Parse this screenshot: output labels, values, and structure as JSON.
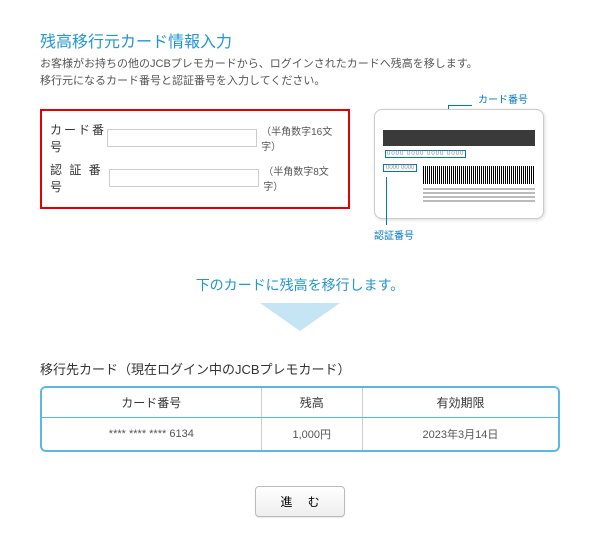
{
  "header": {
    "title": "残高移行元カード情報入力",
    "desc_line1": "お客様がお持ちの他のJCBプレモカードから、ログインされたカードへ残高を移します。",
    "desc_line2": "移行元になるカード番号と認証番号を入力してください。"
  },
  "form": {
    "card_label": "カード番号",
    "card_hint": "（半角数字16文字）",
    "auth_label": "認 証 番 号",
    "auth_hint": "（半角数字8文字）"
  },
  "card_callouts": {
    "card_number": "カード番号",
    "auth_number": "認証番号",
    "sample_digits": "0000 0000 0000 0000",
    "sample_sec": "0000 0000"
  },
  "transfer_text": "下のカードに残高を移行します。",
  "dest": {
    "title": "移行先カード（現在ログイン中のJCBプレモカード）",
    "col_card": "カード番号",
    "col_balance": "残高",
    "col_expiry": "有効期限",
    "row": {
      "card": "**** **** **** 6134",
      "balance": "1,000円",
      "expiry": "2023年3月14日"
    }
  },
  "buttons": {
    "proceed": "進 む"
  }
}
